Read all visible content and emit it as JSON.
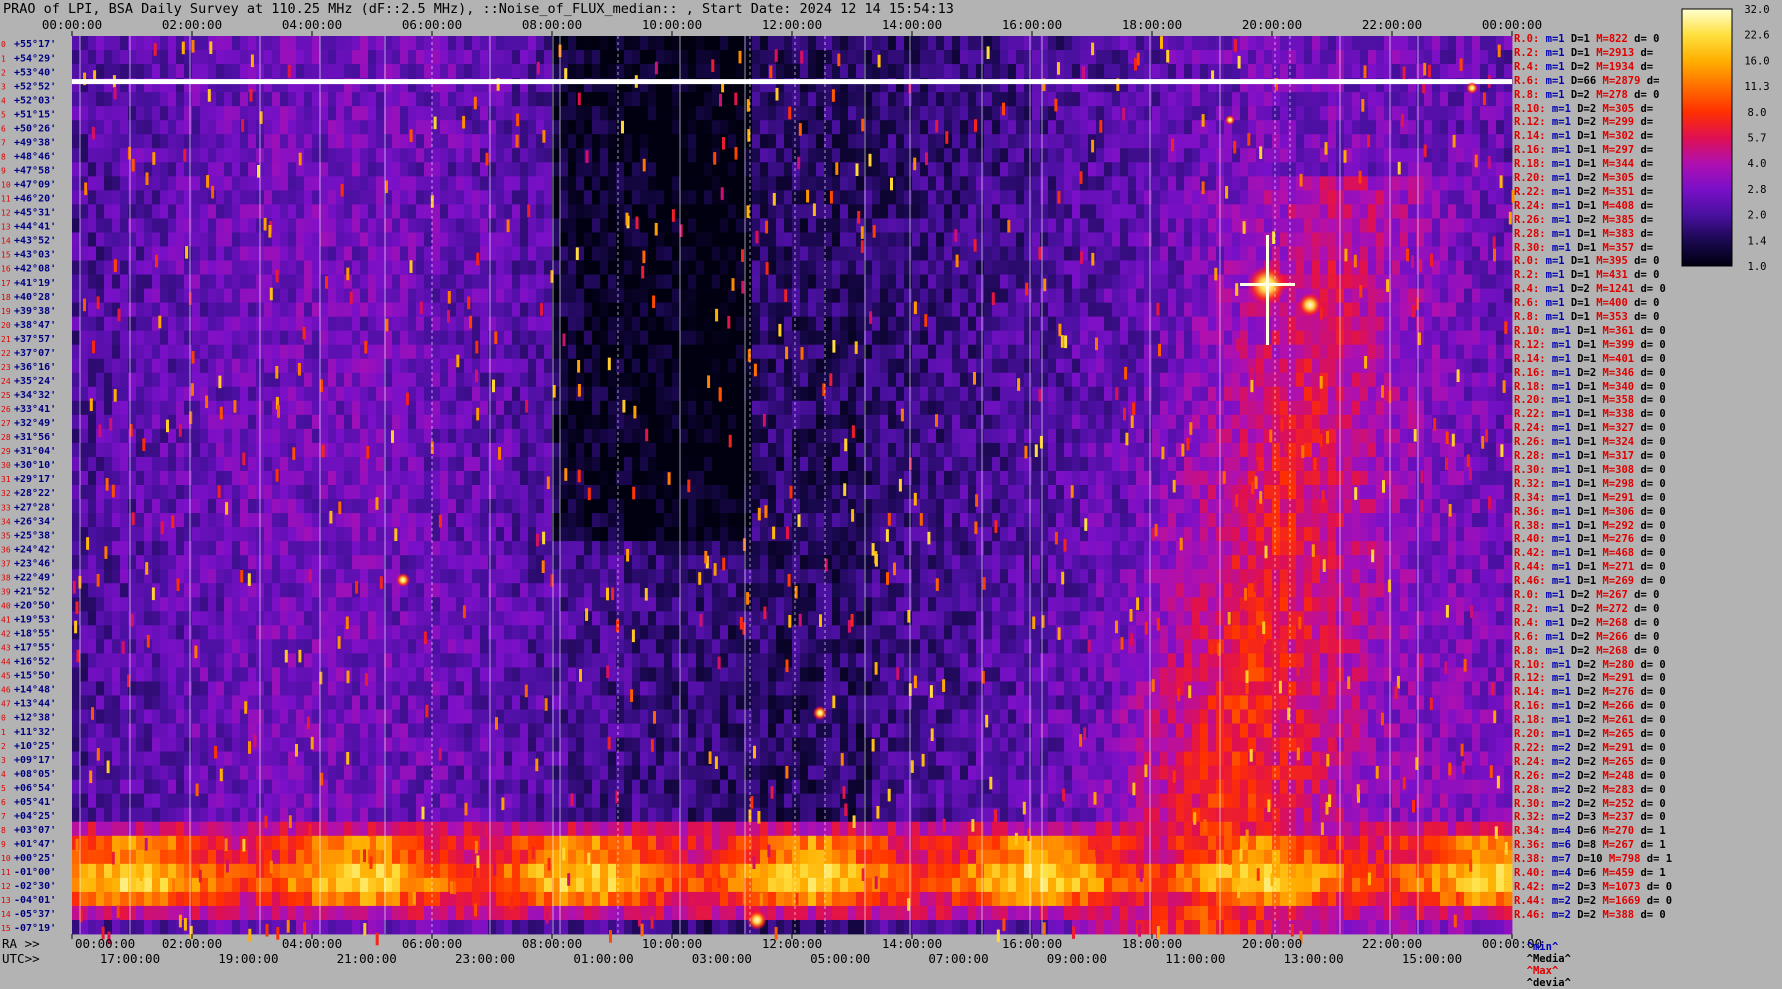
{
  "title": "PRAO of LPI, BSA Daily Survey at 110.25 MHz (dF::2.5 MHz), ::Noise_of_FLUX_median:: , Start Date: 2024 12 14 15:54:13",
  "bottom_labels": {
    "ra_prefix": "RA >>",
    "utc_prefix": "UTC>>"
  },
  "colors": {
    "background": "#b3b3b3",
    "accent_red": "#e00000",
    "accent_blue": "#0000b0"
  },
  "colorbar": {
    "ticks": [
      "32.0",
      "22.6",
      "16.0",
      "11.3",
      "8.0",
      "5.7",
      "4.0",
      "2.8",
      "2.0",
      "1.4",
      "1.0"
    ],
    "scale": "log",
    "colormap": [
      "#000010",
      "#1a0850",
      "#4a10a0",
      "#7a10c8",
      "#b010b0",
      "#e01050",
      "#ff3000",
      "#ff7000",
      "#ffb000",
      "#ffe040",
      "#ffffd0"
    ]
  },
  "chart_data": {
    "type": "heatmap",
    "title": "PRAO of LPI, BSA Daily Survey at 110.25 MHz (dF::2.5 MHz), ::Noise_of_FLUX_median:: , Start Date: 2024 12 14 15:54:13",
    "x_top_ticks": [
      "00:00:00",
      "02:00:00",
      "04:00:00",
      "06:00:00",
      "08:00:00",
      "10:00:00",
      "12:00:00",
      "14:00:00",
      "16:00:00",
      "18:00:00",
      "20:00:00",
      "22:00:00",
      "00:00:00"
    ],
    "x_ra_ticks": [
      "00:00:00",
      "02:00:00",
      "04:00:00",
      "06:00:00",
      "08:00:00",
      "10:00:00",
      "12:00:00",
      "14:00:00",
      "16:00:00",
      "18:00:00",
      "20:00:00",
      "22:00:00",
      "00:00:00"
    ],
    "x_utc_ticks": [
      "17:00:00",
      "19:00:00",
      "21:00:00",
      "23:00:00",
      "01:00:00",
      "03:00:00",
      "05:00:00",
      "07:00:00",
      "09:00:00",
      "11:00:00",
      "13:00:00",
      "15:00:00"
    ],
    "y_labels": [
      {
        "idx": "0",
        "dec": "+55°17'"
      },
      {
        "idx": "1",
        "dec": "+54°29'"
      },
      {
        "idx": "2",
        "dec": "+53°40'"
      },
      {
        "idx": "3",
        "dec": "+52°52'"
      },
      {
        "idx": "4",
        "dec": "+52°03'"
      },
      {
        "idx": "5",
        "dec": "+51°15'"
      },
      {
        "idx": "6",
        "dec": "+50°26'"
      },
      {
        "idx": "7",
        "dec": "+49°38'"
      },
      {
        "idx": "8",
        "dec": "+48°46'"
      },
      {
        "idx": "9",
        "dec": "+47°58'"
      },
      {
        "idx": "10",
        "dec": "+47°09'"
      },
      {
        "idx": "11",
        "dec": "+46°20'"
      },
      {
        "idx": "12",
        "dec": "+45°31'"
      },
      {
        "idx": "13",
        "dec": "+44°41'"
      },
      {
        "idx": "14",
        "dec": "+43°52'"
      },
      {
        "idx": "15",
        "dec": "+43°03'"
      },
      {
        "idx": "16",
        "dec": "+42°08'"
      },
      {
        "idx": "17",
        "dec": "+41°19'"
      },
      {
        "idx": "18",
        "dec": "+40°28'"
      },
      {
        "idx": "19",
        "dec": "+39°38'"
      },
      {
        "idx": "20",
        "dec": "+38°47'"
      },
      {
        "idx": "21",
        "dec": "+37°57'"
      },
      {
        "idx": "22",
        "dec": "+37°07'"
      },
      {
        "idx": "23",
        "dec": "+36°16'"
      },
      {
        "idx": "24",
        "dec": "+35°24'"
      },
      {
        "idx": "25",
        "dec": "+34°32'"
      },
      {
        "idx": "26",
        "dec": "+33°41'"
      },
      {
        "idx": "27",
        "dec": "+32°49'"
      },
      {
        "idx": "28",
        "dec": "+31°56'"
      },
      {
        "idx": "29",
        "dec": "+31°04'"
      },
      {
        "idx": "30",
        "dec": "+30°10'"
      },
      {
        "idx": "31",
        "dec": "+29°17'"
      },
      {
        "idx": "32",
        "dec": "+28°22'"
      },
      {
        "idx": "33",
        "dec": "+27°28'"
      },
      {
        "idx": "34",
        "dec": "+26°34'"
      },
      {
        "idx": "35",
        "dec": "+25°38'"
      },
      {
        "idx": "36",
        "dec": "+24°42'"
      },
      {
        "idx": "37",
        "dec": "+23°46'"
      },
      {
        "idx": "38",
        "dec": "+22°49'"
      },
      {
        "idx": "39",
        "dec": "+21°52'"
      },
      {
        "idx": "40",
        "dec": "+20°50'"
      },
      {
        "idx": "41",
        "dec": "+19°53'"
      },
      {
        "idx": "42",
        "dec": "+18°55'"
      },
      {
        "idx": "43",
        "dec": "+17°55'"
      },
      {
        "idx": "44",
        "dec": "+16°52'"
      },
      {
        "idx": "45",
        "dec": "+15°50'"
      },
      {
        "idx": "46",
        "dec": "+14°48'"
      },
      {
        "idx": "47",
        "dec": "+13°44'"
      },
      {
        "idx": "0",
        "dec": "+12°38'"
      },
      {
        "idx": "1",
        "dec": "+11°32'"
      },
      {
        "idx": "2",
        "dec": "+10°25'"
      },
      {
        "idx": "3",
        "dec": "+09°17'"
      },
      {
        "idx": "4",
        "dec": "+08°05'"
      },
      {
        "idx": "5",
        "dec": "+06°54'"
      },
      {
        "idx": "6",
        "dec": "+05°41'"
      },
      {
        "idx": "7",
        "dec": "+04°25'"
      },
      {
        "idx": "8",
        "dec": "+03°07'"
      },
      {
        "idx": "9",
        "dec": "+01°47'"
      },
      {
        "idx": "10",
        "dec": "+00°25'"
      },
      {
        "idx": "11",
        "dec": "-01°00'"
      },
      {
        "idx": "12",
        "dec": "-02°30'"
      },
      {
        "idx": "13",
        "dec": "-04°01'"
      },
      {
        "idx": "14",
        "dec": "-05°37'"
      },
      {
        "idx": "15",
        "dec": "-07°19'"
      }
    ],
    "row_stats": [
      {
        "r": "R.0:",
        "m": "m=1",
        "d": "D=1",
        "mx": "M=822",
        "dv": "d= 0"
      },
      {
        "r": "R.2:",
        "m": "m=1",
        "d": "D=1",
        "mx": "M=2913",
        "dv": "d="
      },
      {
        "r": "R.4:",
        "m": "m=1",
        "d": "D=2",
        "mx": "M=1934",
        "dv": "d="
      },
      {
        "r": "R.6:",
        "m": "m=1",
        "d": "D=66",
        "mx": "M=2879",
        "dv": "d="
      },
      {
        "r": "R.8:",
        "m": "m=1",
        "d": "D=2",
        "mx": "M=278",
        "dv": "d= 0"
      },
      {
        "r": "R.10:",
        "m": "m=1",
        "d": "D=2",
        "mx": "M=305",
        "dv": "d="
      },
      {
        "r": "R.12:",
        "m": "m=1",
        "d": "D=2",
        "mx": "M=299",
        "dv": "d="
      },
      {
        "r": "R.14:",
        "m": "m=1",
        "d": "D=1",
        "mx": "M=302",
        "dv": "d="
      },
      {
        "r": "R.16:",
        "m": "m=1",
        "d": "D=1",
        "mx": "M=297",
        "dv": "d="
      },
      {
        "r": "R.18:",
        "m": "m=1",
        "d": "D=1",
        "mx": "M=344",
        "dv": "d="
      },
      {
        "r": "R.20:",
        "m": "m=1",
        "d": "D=2",
        "mx": "M=305",
        "dv": "d="
      },
      {
        "r": "R.22:",
        "m": "m=1",
        "d": "D=2",
        "mx": "M=351",
        "dv": "d="
      },
      {
        "r": "R.24:",
        "m": "m=1",
        "d": "D=1",
        "mx": "M=408",
        "dv": "d="
      },
      {
        "r": "R.26:",
        "m": "m=1",
        "d": "D=2",
        "mx": "M=385",
        "dv": "d="
      },
      {
        "r": "R.28:",
        "m": "m=1",
        "d": "D=1",
        "mx": "M=383",
        "dv": "d="
      },
      {
        "r": "R.30:",
        "m": "m=1",
        "d": "D=1",
        "mx": "M=357",
        "dv": "d="
      },
      {
        "r": "R.0:",
        "m": "m=1",
        "d": "D=1",
        "mx": "M=395",
        "dv": "d= 0"
      },
      {
        "r": "R.2:",
        "m": "m=1",
        "d": "D=1",
        "mx": "M=431",
        "dv": "d= 0"
      },
      {
        "r": "R.4:",
        "m": "m=1",
        "d": "D=2",
        "mx": "M=1241",
        "dv": "d= 0"
      },
      {
        "r": "R.6:",
        "m": "m=1",
        "d": "D=1",
        "mx": "M=400",
        "dv": "d= 0"
      },
      {
        "r": "R.8:",
        "m": "m=1",
        "d": "D=1",
        "mx": "M=353",
        "dv": "d= 0"
      },
      {
        "r": "R.10:",
        "m": "m=1",
        "d": "D=1",
        "mx": "M=361",
        "dv": "d= 0"
      },
      {
        "r": "R.12:",
        "m": "m=1",
        "d": "D=1",
        "mx": "M=399",
        "dv": "d= 0"
      },
      {
        "r": "R.14:",
        "m": "m=1",
        "d": "D=1",
        "mx": "M=401",
        "dv": "d= 0"
      },
      {
        "r": "R.16:",
        "m": "m=1",
        "d": "D=2",
        "mx": "M=346",
        "dv": "d= 0"
      },
      {
        "r": "R.18:",
        "m": "m=1",
        "d": "D=1",
        "mx": "M=340",
        "dv": "d= 0"
      },
      {
        "r": "R.20:",
        "m": "m=1",
        "d": "D=1",
        "mx": "M=358",
        "dv": "d= 0"
      },
      {
        "r": "R.22:",
        "m": "m=1",
        "d": "D=1",
        "mx": "M=338",
        "dv": "d= 0"
      },
      {
        "r": "R.24:",
        "m": "m=1",
        "d": "D=1",
        "mx": "M=327",
        "dv": "d= 0"
      },
      {
        "r": "R.26:",
        "m": "m=1",
        "d": "D=1",
        "mx": "M=324",
        "dv": "d= 0"
      },
      {
        "r": "R.28:",
        "m": "m=1",
        "d": "D=1",
        "mx": "M=317",
        "dv": "d= 0"
      },
      {
        "r": "R.30:",
        "m": "m=1",
        "d": "D=1",
        "mx": "M=308",
        "dv": "d= 0"
      },
      {
        "r": "R.32:",
        "m": "m=1",
        "d": "D=1",
        "mx": "M=298",
        "dv": "d= 0"
      },
      {
        "r": "R.34:",
        "m": "m=1",
        "d": "D=1",
        "mx": "M=291",
        "dv": "d= 0"
      },
      {
        "r": "R.36:",
        "m": "m=1",
        "d": "D=1",
        "mx": "M=306",
        "dv": "d= 0"
      },
      {
        "r": "R.38:",
        "m": "m=1",
        "d": "D=1",
        "mx": "M=292",
        "dv": "d= 0"
      },
      {
        "r": "R.40:",
        "m": "m=1",
        "d": "D=1",
        "mx": "M=276",
        "dv": "d= 0"
      },
      {
        "r": "R.42:",
        "m": "m=1",
        "d": "D=1",
        "mx": "M=468",
        "dv": "d= 0"
      },
      {
        "r": "R.44:",
        "m": "m=1",
        "d": "D=1",
        "mx": "M=271",
        "dv": "d= 0"
      },
      {
        "r": "R.46:",
        "m": "m=1",
        "d": "D=1",
        "mx": "M=269",
        "dv": "d= 0"
      },
      {
        "r": "R.0:",
        "m": "m=1",
        "d": "D=2",
        "mx": "M=267",
        "dv": "d= 0"
      },
      {
        "r": "R.2:",
        "m": "m=1",
        "d": "D=2",
        "mx": "M=272",
        "dv": "d= 0"
      },
      {
        "r": "R.4:",
        "m": "m=1",
        "d": "D=2",
        "mx": "M=268",
        "dv": "d= 0"
      },
      {
        "r": "R.6:",
        "m": "m=1",
        "d": "D=2",
        "mx": "M=266",
        "dv": "d= 0"
      },
      {
        "r": "R.8:",
        "m": "m=1",
        "d": "D=2",
        "mx": "M=268",
        "dv": "d= 0"
      },
      {
        "r": "R.10:",
        "m": "m=1",
        "d": "D=2",
        "mx": "M=280",
        "dv": "d= 0"
      },
      {
        "r": "R.12:",
        "m": "m=1",
        "d": "D=2",
        "mx": "M=291",
        "dv": "d= 0"
      },
      {
        "r": "R.14:",
        "m": "m=1",
        "d": "D=2",
        "mx": "M=276",
        "dv": "d= 0"
      },
      {
        "r": "R.16:",
        "m": "m=1",
        "d": "D=2",
        "mx": "M=266",
        "dv": "d= 0"
      },
      {
        "r": "R.18:",
        "m": "m=1",
        "d": "D=2",
        "mx": "M=261",
        "dv": "d= 0"
      },
      {
        "r": "R.20:",
        "m": "m=1",
        "d": "D=2",
        "mx": "M=265",
        "dv": "d= 0"
      },
      {
        "r": "R.22:",
        "m": "m=2",
        "d": "D=2",
        "mx": "M=291",
        "dv": "d= 0"
      },
      {
        "r": "R.24:",
        "m": "m=2",
        "d": "D=2",
        "mx": "M=265",
        "dv": "d= 0"
      },
      {
        "r": "R.26:",
        "m": "m=2",
        "d": "D=2",
        "mx": "M=248",
        "dv": "d= 0"
      },
      {
        "r": "R.28:",
        "m": "m=2",
        "d": "D=2",
        "mx": "M=283",
        "dv": "d= 0"
      },
      {
        "r": "R.30:",
        "m": "m=2",
        "d": "D=2",
        "mx": "M=252",
        "dv": "d= 0"
      },
      {
        "r": "R.32:",
        "m": "m=2",
        "d": "D=3",
        "mx": "M=237",
        "dv": "d= 0"
      },
      {
        "r": "R.34:",
        "m": "m=4",
        "d": "D=6",
        "mx": "M=270",
        "dv": "d= 1"
      },
      {
        "r": "R.36:",
        "m": "m=6",
        "d": "D=8",
        "mx": "M=267",
        "dv": "d= 1"
      },
      {
        "r": "R.38:",
        "m": "m=7",
        "d": "D=10",
        "mx": "M=798",
        "dv": "d= 1"
      },
      {
        "r": "R.40:",
        "m": "m=4",
        "d": "D=6",
        "mx": "M=459",
        "dv": "d= 1"
      },
      {
        "r": "R.42:",
        "m": "m=2",
        "d": "D=3",
        "mx": "M=1073",
        "dv": "d= 0"
      },
      {
        "r": "R.44:",
        "m": "m=2",
        "d": "D=2",
        "mx": "M=1669",
        "dv": "d= 0"
      },
      {
        "r": "R.46:",
        "m": "m=2",
        "d": "D=2",
        "mx": "M=388",
        "dv": "d= 0"
      }
    ],
    "legend": [
      "^min^",
      "^Media^",
      "^Max^",
      "^devia^"
    ]
  }
}
